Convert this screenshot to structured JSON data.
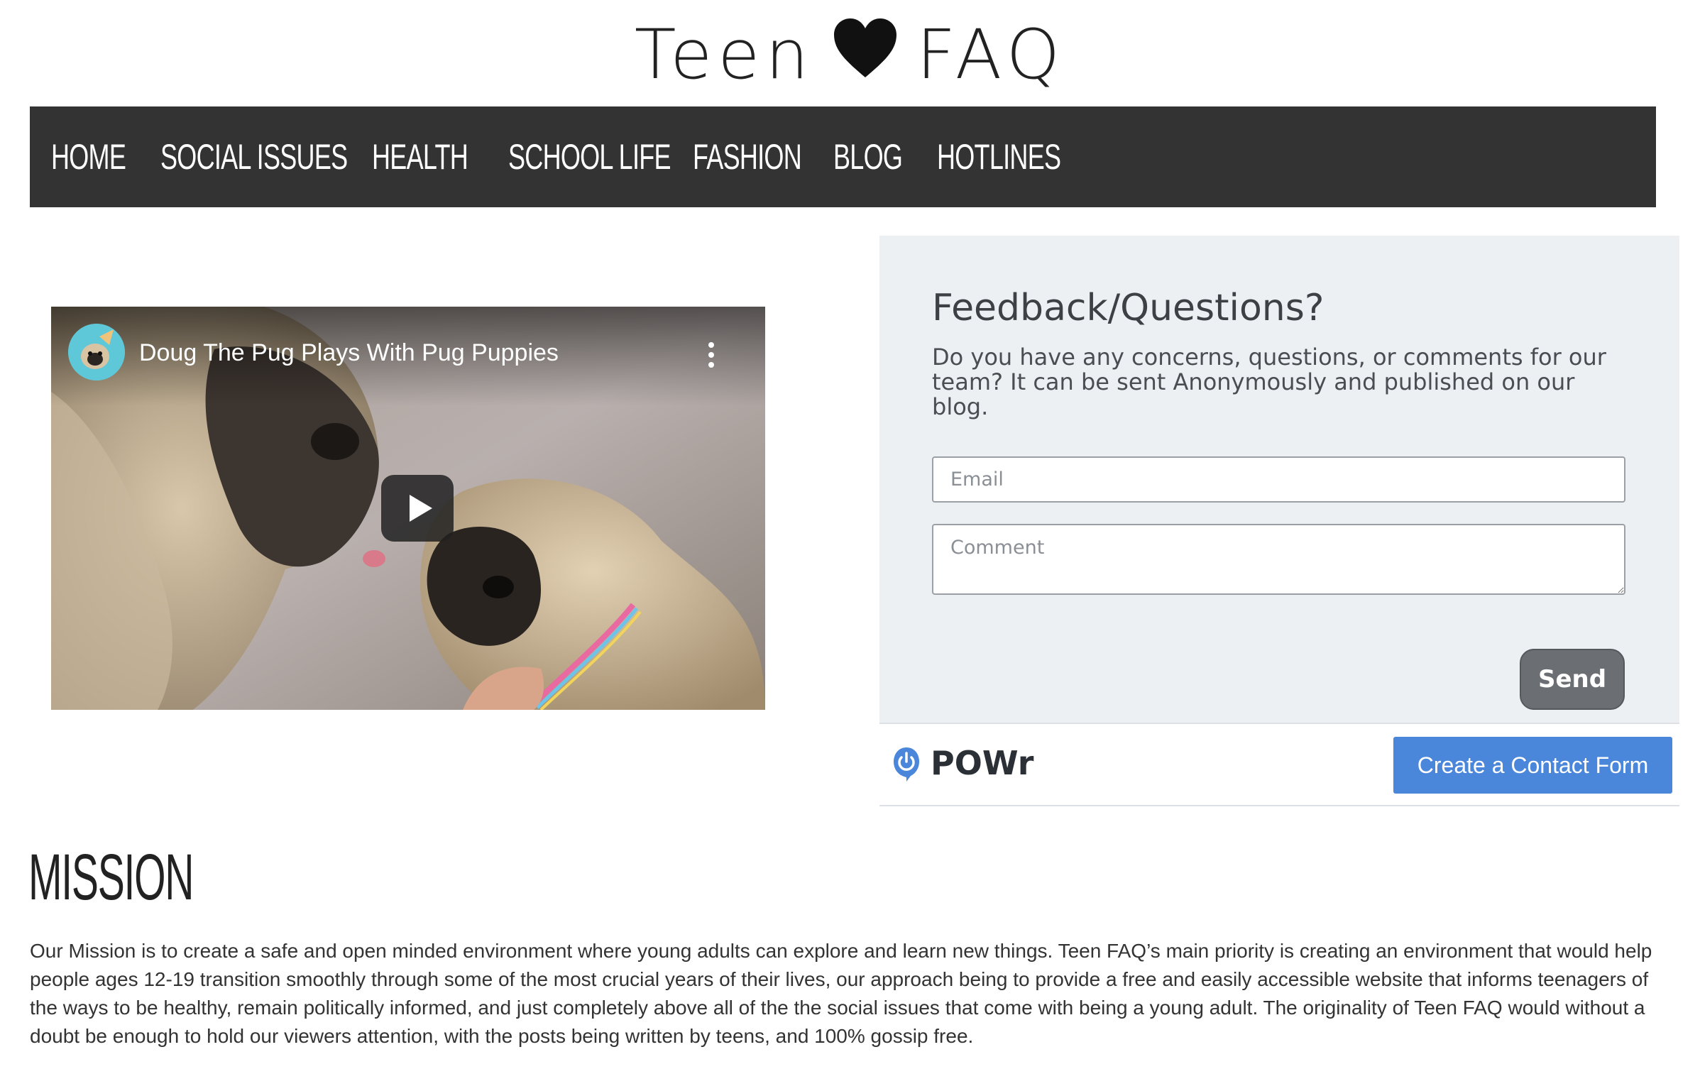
{
  "logo": {
    "left_word": "Teen",
    "right_word": "FAQ",
    "icon": "heart-icon"
  },
  "nav": {
    "items": [
      {
        "label": "HOME"
      },
      {
        "label": "SOCIAL ISSUES"
      },
      {
        "label": "HEALTH"
      },
      {
        "label": "SCHOOL LIFE"
      },
      {
        "label": "FASHION"
      },
      {
        "label": "BLOG"
      },
      {
        "label": "HOTLINES"
      }
    ]
  },
  "video": {
    "title": "Doug The Pug Plays With Pug Puppies",
    "icons": [
      "channel-avatar",
      "more-vert-icon",
      "play-icon"
    ]
  },
  "feedback": {
    "title": "Feedback/Questions?",
    "description": "Do you have any concerns, questions, or comments for our team? It can be sent Anonymously and published on our blog.",
    "email_placeholder": "Email",
    "comment_placeholder": "Comment",
    "send_label": "Send"
  },
  "powr": {
    "brand": "POWr",
    "cta_label": "Create a Contact Form"
  },
  "mission": {
    "heading": "MISSION",
    "body": "Our Mission is to create a safe and open minded environment where young adults can explore and learn new things. Teen FAQ’s main priority is creating an environment that would help people ages 12-19 transition smoothly through some of the most crucial years of their lives, our approach being to provide a free and easily accessible website that informs teenagers of the ways to be healthy, remain politically informed, and just completely above all of the the social issues that come with being a young adult. The originality of Teen FAQ would without a doubt be enough to hold our viewers attention, with the posts being written by teens, and 100% gossip free."
  },
  "colors": {
    "nav_background": "#333333",
    "feedback_background": "#edf0f3",
    "send_button": "#6b6f73",
    "cta_button": "#4a86d9"
  }
}
